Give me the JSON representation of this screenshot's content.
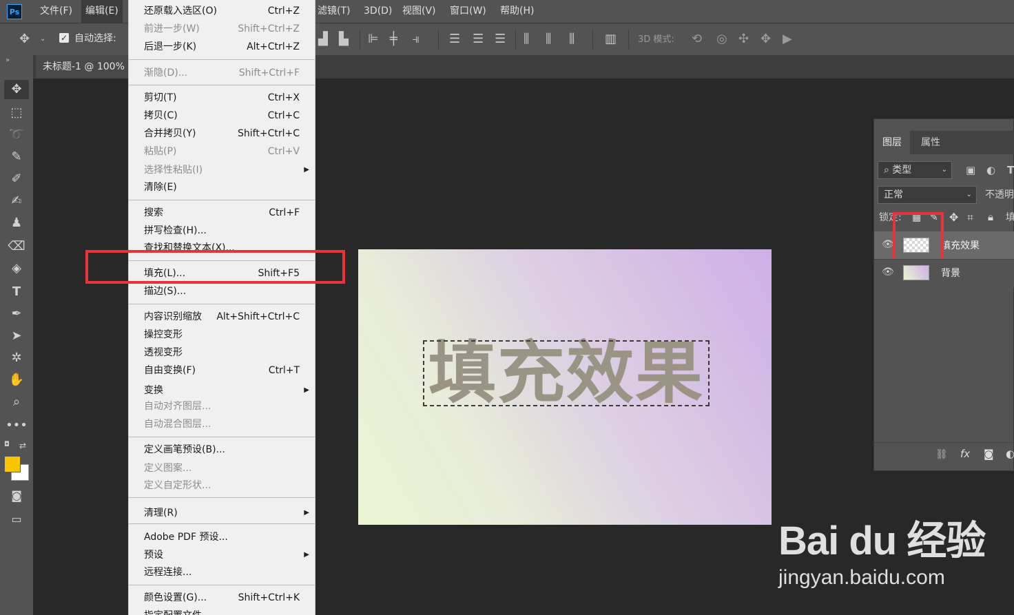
{
  "app": {
    "logo": "Ps"
  },
  "menubar": {
    "file": "文件(F)",
    "edit": "编辑(E)",
    "filter": "滤镜(T)",
    "threed": "3D(D)",
    "view": "视图(V)",
    "window": "窗口(W)",
    "help": "帮助(H)"
  },
  "options": {
    "auto_select_label": "自动选择:",
    "auto_select_checked": true,
    "mode3d_label": "3D 模式:"
  },
  "document": {
    "tab_title": "未标题-1 @ 100%"
  },
  "edit_menu": {
    "items": [
      {
        "label": "还原载入选区(O)",
        "shortcut": "Ctrl+Z",
        "enabled": true
      },
      {
        "label": "前进一步(W)",
        "shortcut": "Shift+Ctrl+Z",
        "enabled": false
      },
      {
        "label": "后退一步(K)",
        "shortcut": "Alt+Ctrl+Z",
        "enabled": true
      },
      {
        "label": "渐隐(D)...",
        "shortcut": "Shift+Ctrl+F",
        "enabled": false
      },
      {
        "label": "剪切(T)",
        "shortcut": "Ctrl+X",
        "enabled": true
      },
      {
        "label": "拷贝(C)",
        "shortcut": "Ctrl+C",
        "enabled": true
      },
      {
        "label": "合并拷贝(Y)",
        "shortcut": "Shift+Ctrl+C",
        "enabled": true
      },
      {
        "label": "粘贴(P)",
        "shortcut": "Ctrl+V",
        "enabled": false
      },
      {
        "label": "选择性粘贴(I)",
        "shortcut": "",
        "enabled": false,
        "submenu": true
      },
      {
        "label": "清除(E)",
        "shortcut": "",
        "enabled": true
      },
      {
        "label": "搜索",
        "shortcut": "Ctrl+F",
        "enabled": true
      },
      {
        "label": "拼写检查(H)...",
        "shortcut": "",
        "enabled": true
      },
      {
        "label": "查找和替换文本(X)...",
        "shortcut": "",
        "enabled": true
      },
      {
        "label": "填充(L)...",
        "shortcut": "Shift+F5",
        "enabled": true
      },
      {
        "label": "描边(S)...",
        "shortcut": "",
        "enabled": true
      },
      {
        "label": "内容识别缩放",
        "shortcut": "Alt+Shift+Ctrl+C",
        "enabled": true
      },
      {
        "label": "操控变形",
        "shortcut": "",
        "enabled": true
      },
      {
        "label": "透视变形",
        "shortcut": "",
        "enabled": true
      },
      {
        "label": "自由变换(F)",
        "shortcut": "Ctrl+T",
        "enabled": true
      },
      {
        "label": "变换",
        "shortcut": "",
        "enabled": true,
        "submenu": true
      },
      {
        "label": "自动对齐图层...",
        "shortcut": "",
        "enabled": false
      },
      {
        "label": "自动混合图层...",
        "shortcut": "",
        "enabled": false
      },
      {
        "label": "定义画笔预设(B)...",
        "shortcut": "",
        "enabled": true
      },
      {
        "label": "定义图案...",
        "shortcut": "",
        "enabled": false
      },
      {
        "label": "定义自定形状...",
        "shortcut": "",
        "enabled": false
      },
      {
        "label": "清理(R)",
        "shortcut": "",
        "enabled": true,
        "submenu": true
      },
      {
        "label": "Adobe PDF 预设...",
        "shortcut": "",
        "enabled": true
      },
      {
        "label": "预设",
        "shortcut": "",
        "enabled": true,
        "submenu": true
      },
      {
        "label": "远程连接...",
        "shortcut": "",
        "enabled": true
      },
      {
        "label": "颜色设置(G)...",
        "shortcut": "Shift+Ctrl+K",
        "enabled": true
      },
      {
        "label": "指定配置文件...",
        "shortcut": "",
        "enabled": true
      }
    ]
  },
  "canvas": {
    "text": "填充效果"
  },
  "layers_panel": {
    "tab_layers": "图层",
    "tab_properties": "属性",
    "filter_kind": "类型",
    "blend_mode": "正常",
    "opacity_label": "不透明",
    "lock_label": "锁定:",
    "fill_label": "填",
    "layers": [
      {
        "name": "填充效果",
        "visible": true,
        "selected": true
      },
      {
        "name": "背景",
        "visible": true,
        "selected": false
      }
    ]
  },
  "watermark": {
    "logo": "Bai du 经验",
    "url": "jingyan.baidu.com"
  }
}
